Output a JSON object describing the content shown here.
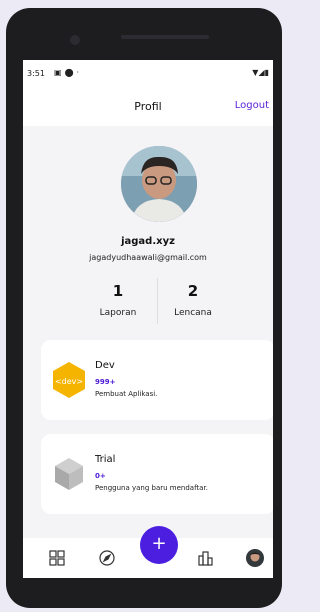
{
  "status_bar": {
    "time": "3:51",
    "left_icons": [
      "image-icon",
      "location-icon",
      "dot-icon"
    ],
    "right_icons": [
      "wifi-icon",
      "signal-icon",
      "battery-icon"
    ]
  },
  "app_bar": {
    "title": "Profil",
    "logout_label": "Logout"
  },
  "profile": {
    "username": "jagad.xyz",
    "email": "jagadyudhaawali@gmail.com"
  },
  "stats": [
    {
      "value": "1",
      "label": "Laporan"
    },
    {
      "value": "2",
      "label": "Lencana"
    }
  ],
  "badges": [
    {
      "name": "Dev",
      "count": "999+",
      "description": "Pembuat Aplikasi.",
      "icon": "dev-hex-icon"
    },
    {
      "name": "Trial",
      "count": "0+",
      "description": "Pengguna yang baru mendaftar.",
      "icon": "cube-icon"
    }
  ],
  "navbar": {
    "items": [
      "grid-icon",
      "compass-icon",
      "add-icon",
      "buildings-icon",
      "avatar"
    ],
    "fab_label": "+"
  },
  "colors": {
    "accent": "#5b22d6",
    "fab": "#4b1ee0",
    "dev_badge": "#f5b400"
  }
}
